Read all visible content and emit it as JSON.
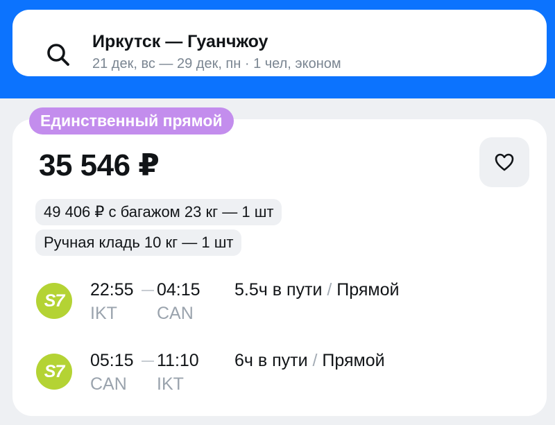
{
  "search": {
    "route": "Иркутск — Гуанчжоу",
    "details": "21 дек, вс — 29 дек, пн · 1 чел, эконом"
  },
  "offer": {
    "badge": "Единственный прямой",
    "price": "35 546 ₽",
    "baggage_chip": "49 406 ₽ с багажом 23 кг — 1 шт",
    "carryon_chip": "Ручная кладь 10 кг — 1 шт"
  },
  "segments": [
    {
      "airline_logo_text": "S7",
      "dep_time": "22:55",
      "arr_time": "04:15",
      "dep_code": "IKT",
      "arr_code": "CAN",
      "duration": "5.5ч в пути",
      "separator": "/",
      "stops": "Прямой"
    },
    {
      "airline_logo_text": "S7",
      "dep_time": "05:15",
      "arr_time": "11:10",
      "dep_code": "CAN",
      "arr_code": "IKT",
      "duration": "6ч в пути",
      "separator": "/",
      "stops": "Прямой"
    }
  ],
  "icons": {
    "search": "search-icon",
    "favorite": "heart-icon",
    "airline": "s7-airline-logo"
  },
  "colors": {
    "header_bg": "#0c73fe",
    "badge_bg": "#c38ded",
    "s7_green": "#b4d334",
    "page_bg": "#eef0f3"
  }
}
